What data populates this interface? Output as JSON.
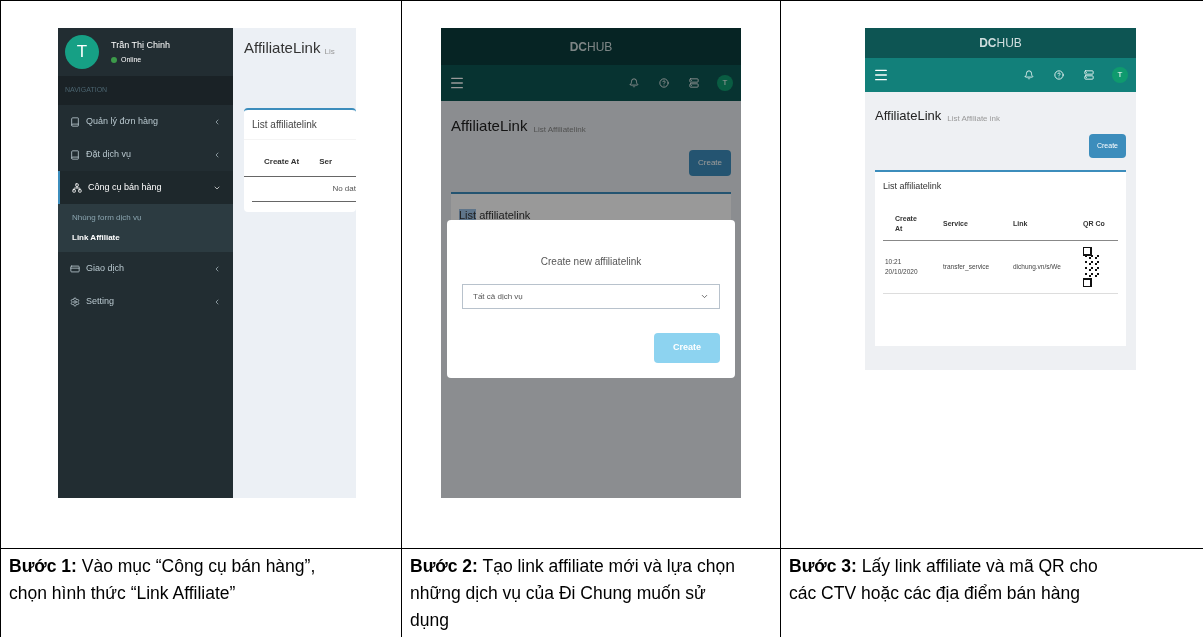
{
  "screen_1": {
    "avatar_letter": "T",
    "user_name": "Trần Thị Chinh",
    "user_status": "Online",
    "nav_header": "NAVIGATION",
    "menu": [
      {
        "label": "Quản lý đơn hàng",
        "expanded": false
      },
      {
        "label": "Đặt dịch vụ",
        "expanded": false
      },
      {
        "label": "Công cụ bán hàng",
        "expanded": true,
        "children": [
          {
            "label": "Nhúng form dịch vụ",
            "selected": false
          },
          {
            "label": "Link Affiliate",
            "selected": true
          }
        ]
      },
      {
        "label": "Giao dịch",
        "expanded": false
      },
      {
        "label": "Setting",
        "expanded": false
      }
    ],
    "page_title": "AffiliateLink",
    "page_subtitle": "Lis",
    "card_title": "List affiliatelink",
    "columns": [
      "Create At",
      "Ser"
    ],
    "empty_text": "No dat"
  },
  "screen_2": {
    "brand_bold": "DC",
    "brand_light": "HUB",
    "avatar_letter": "T",
    "page_title": "AffiliateLink",
    "page_subtitle": "List Affiliatelink",
    "create_button": "Create",
    "card_title_highlighted": "List",
    "card_title_rest": "affiliatelink",
    "modal": {
      "title": "Create new affiliatelink",
      "select_value": "Tất cả dịch vụ",
      "submit_button": "Create",
      "submit_disabled": true
    }
  },
  "screen_3": {
    "brand_bold": "DC",
    "brand_light": "HUB",
    "avatar_letter": "T",
    "page_title": "AffiliateLink",
    "page_subtitle": "List Affiliate ink",
    "create_button": "Create",
    "card_title": "List affiliatelink",
    "columns": [
      "Create At",
      "Service",
      "Link",
      "QR Co"
    ],
    "rows": [
      {
        "create_at": "10:21 20/10/2020",
        "service": "transfer_service",
        "link": "dichung.vn/s/We"
      }
    ]
  },
  "captions": [
    "**Bước 1:** Vào mục “Công cụ bán hàng”, chọn hình thức “Link Affiliate”",
    "**Bước 2:** Tạo link affiliate mới và lựa chọn những dịch vụ của Đi Chung muốn sử dụng",
    "**Bước 3:** Lấy link affiliate và mã QR cho các CTV hoặc các địa điểm bán hàng"
  ]
}
